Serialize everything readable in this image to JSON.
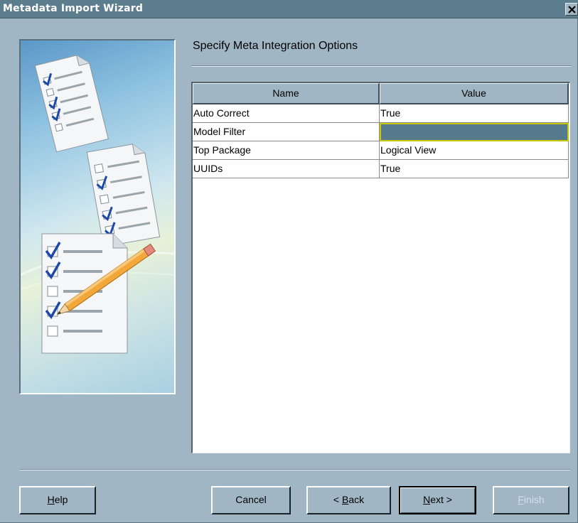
{
  "window": {
    "title": "Metadata Import Wizard",
    "close_icon": "close-icon"
  },
  "page": {
    "section_title": "Specify Meta Integration Options"
  },
  "table": {
    "columns": [
      "Name",
      "Value"
    ],
    "rows": [
      {
        "name": "Auto Correct",
        "value": "True"
      },
      {
        "name": "Model Filter",
        "value": ""
      },
      {
        "name": "Top Package",
        "value": "Logical View"
      },
      {
        "name": "UUIDs",
        "value": "True"
      }
    ],
    "selected_row": 1,
    "selected_color": "#557a8b"
  },
  "buttons": {
    "help": {
      "label": "Help",
      "mnemonic": "H",
      "rest": "elp"
    },
    "cancel": {
      "label": "Cancel"
    },
    "back": {
      "label": "< Back",
      "pre": "< ",
      "mnemonic": "B",
      "rest": "ack"
    },
    "next": {
      "label": "Next >",
      "mnemonic": "N",
      "rest": "ext >"
    },
    "finish": {
      "label": "Finish",
      "mnemonic": "F",
      "rest": "inish",
      "enabled": false
    }
  }
}
